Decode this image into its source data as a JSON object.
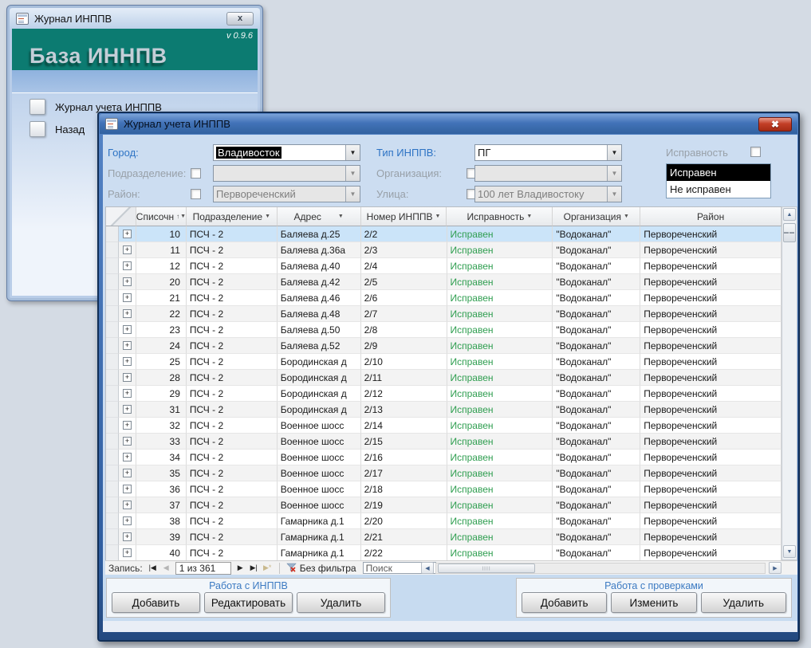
{
  "colors": {
    "teal_header": "#0c7b71",
    "label_blue": "#2d73c4",
    "status_green": "#2f9e50",
    "selected_row": "#cbe4f9",
    "title_bar_blue": "#4273b8"
  },
  "icons": {
    "dropdown": "▼",
    "sort_asc": "↑",
    "expand": "+",
    "first": "|◀",
    "prev": "◀",
    "next": "▶",
    "last": "▶|",
    "new_record": "▶*",
    "scroll_left": "◀",
    "scroll_right": "▶",
    "scroll_up": "▲",
    "scroll_down": "▼",
    "grip_h": "▬▬",
    "grip_v": "||||",
    "close_gray": "x",
    "close_red": "✖"
  },
  "launcher": {
    "title": "Журнал ИНППВ",
    "version": "v 0.9.6",
    "heading": "База ИННПВ",
    "items": [
      {
        "label": "Журнал учета ИНППВ"
      },
      {
        "label": "Назад"
      }
    ]
  },
  "main": {
    "title": "Журнал учета ИНППВ",
    "filters": {
      "city": {
        "label": "Город:",
        "value": "Владивосток",
        "enabled": true
      },
      "type": {
        "label": "Тип ИНППВ:",
        "value": "ПГ",
        "enabled": true
      },
      "subdivision": {
        "label": "Подразделение:",
        "value": "",
        "enabled": false
      },
      "organization": {
        "label": "Организация:",
        "value": "",
        "enabled": false
      },
      "district": {
        "label": "Район:",
        "value": "Первореченский",
        "enabled": false
      },
      "street": {
        "label": "Улица:",
        "value": "100 лет Владивостоку",
        "enabled": false
      },
      "status_label": "Исправность",
      "status_options": [
        "Исправен",
        "Не исправен"
      ],
      "status_selected": "Исправен"
    },
    "table": {
      "columns": [
        "Списочн",
        "Подразделение",
        "Адрес",
        "Номер ИНППВ",
        "Исправность",
        "Организация",
        "Район"
      ],
      "sorted_column": "Списочн",
      "rows": [
        [
          "10",
          "ПСЧ - 2",
          "Баляева д.25",
          "2/2",
          "Исправен",
          "\"Водоканал\"",
          "Первореченский"
        ],
        [
          "11",
          "ПСЧ - 2",
          "Баляева д.36а",
          "2/3",
          "Исправен",
          "\"Водоканал\"",
          "Первореченский"
        ],
        [
          "12",
          "ПСЧ - 2",
          "Баляева д.40",
          "2/4",
          "Исправен",
          "\"Водоканал\"",
          "Первореченский"
        ],
        [
          "20",
          "ПСЧ - 2",
          "Баляева д.42",
          "2/5",
          "Исправен",
          "\"Водоканал\"",
          "Первореченский"
        ],
        [
          "21",
          "ПСЧ - 2",
          "Баляева д.46",
          "2/6",
          "Исправен",
          "\"Водоканал\"",
          "Первореченский"
        ],
        [
          "22",
          "ПСЧ - 2",
          "Баляева д.48",
          "2/7",
          "Исправен",
          "\"Водоканал\"",
          "Первореченский"
        ],
        [
          "23",
          "ПСЧ - 2",
          "Баляева д.50",
          "2/8",
          "Исправен",
          "\"Водоканал\"",
          "Первореченский"
        ],
        [
          "24",
          "ПСЧ - 2",
          "Баляева д.52",
          "2/9",
          "Исправен",
          "\"Водоканал\"",
          "Первореченский"
        ],
        [
          "25",
          "ПСЧ - 2",
          "Бородинская д",
          "2/10",
          "Исправен",
          "\"Водоканал\"",
          "Первореченский"
        ],
        [
          "28",
          "ПСЧ - 2",
          "Бородинская д",
          "2/11",
          "Исправен",
          "\"Водоканал\"",
          "Первореченский"
        ],
        [
          "29",
          "ПСЧ - 2",
          "Бородинская д",
          "2/12",
          "Исправен",
          "\"Водоканал\"",
          "Первореченский"
        ],
        [
          "31",
          "ПСЧ - 2",
          "Бородинская д",
          "2/13",
          "Исправен",
          "\"Водоканал\"",
          "Первореченский"
        ],
        [
          "32",
          "ПСЧ - 2",
          "Военное шосс",
          "2/14",
          "Исправен",
          "\"Водоканал\"",
          "Первореченский"
        ],
        [
          "33",
          "ПСЧ - 2",
          "Военное шосс",
          "2/15",
          "Исправен",
          "\"Водоканал\"",
          "Первореченский"
        ],
        [
          "34",
          "ПСЧ - 2",
          "Военное шосс",
          "2/16",
          "Исправен",
          "\"Водоканал\"",
          "Первореченский"
        ],
        [
          "35",
          "ПСЧ - 2",
          "Военное шосс",
          "2/17",
          "Исправен",
          "\"Водоканал\"",
          "Первореченский"
        ],
        [
          "36",
          "ПСЧ - 2",
          "Военное шосс",
          "2/18",
          "Исправен",
          "\"Водоканал\"",
          "Первореченский"
        ],
        [
          "37",
          "ПСЧ - 2",
          "Военное шосс",
          "2/19",
          "Исправен",
          "\"Водоканал\"",
          "Первореченский"
        ],
        [
          "38",
          "ПСЧ - 2",
          "Гамарника д.1",
          "2/20",
          "Исправен",
          "\"Водоканал\"",
          "Первореченский"
        ],
        [
          "39",
          "ПСЧ - 2",
          "Гамарника д.1",
          "2/21",
          "Исправен",
          "\"Водоканал\"",
          "Первореченский"
        ],
        [
          "40",
          "ПСЧ - 2",
          "Гамарника д.1",
          "2/22",
          "Исправен",
          "\"Водоканал\"",
          "Первореченский"
        ]
      ]
    },
    "nav": {
      "record_label": "Запись:",
      "position": "1 из 361",
      "filter_label": "Без фильтра",
      "search_placeholder": "Поиск"
    },
    "left_panel": {
      "title": "Работа с ИНППВ",
      "buttons": [
        "Добавить",
        "Редактировать",
        "Удалить"
      ]
    },
    "right_panel": {
      "title": "Работа с проверками",
      "buttons": [
        "Добавить",
        "Изменить",
        "Удалить"
      ]
    }
  }
}
